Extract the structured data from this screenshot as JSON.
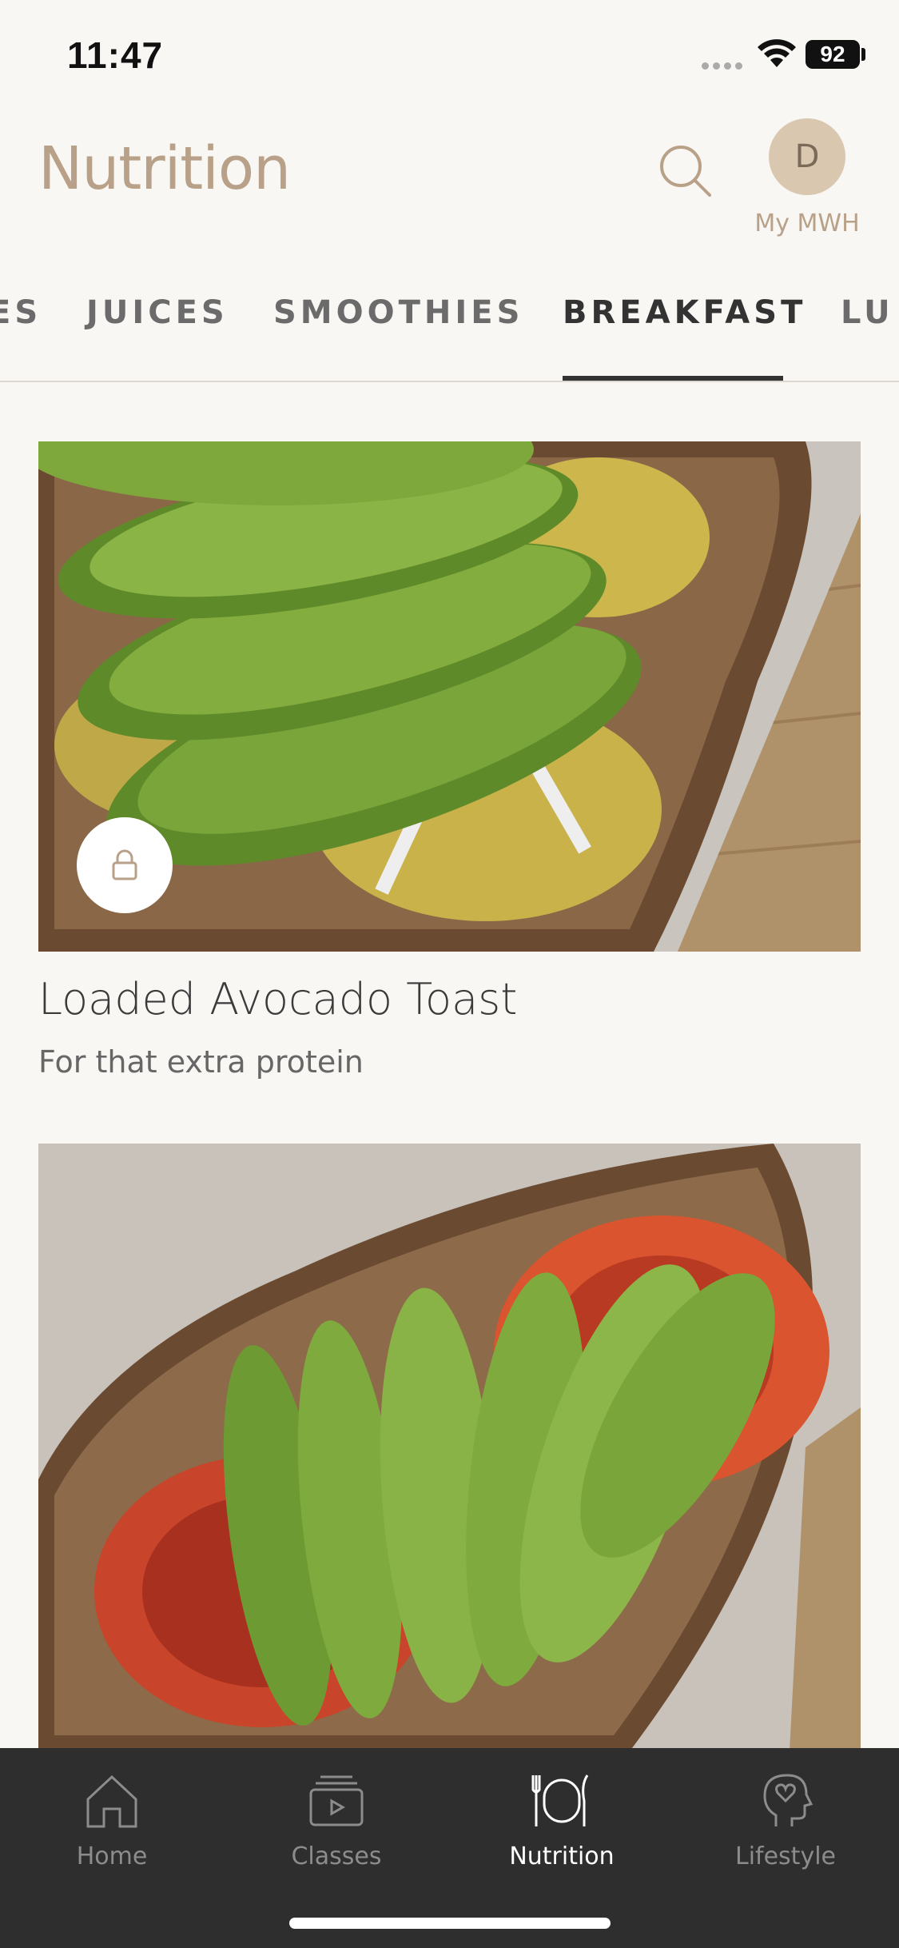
{
  "status_bar": {
    "time": "11:47",
    "battery": "92"
  },
  "header": {
    "title": "Nutrition",
    "avatar_initial": "D",
    "avatar_label": "My MWH"
  },
  "tabs": [
    {
      "label": "ES",
      "active": false
    },
    {
      "label": "JUICES",
      "active": false
    },
    {
      "label": "SMOOTHIES",
      "active": false
    },
    {
      "label": "BREAKFAST",
      "active": true
    },
    {
      "label": "LU",
      "active": false
    }
  ],
  "recipes": [
    {
      "title": "Loaded Avocado Toast",
      "subtitle": "For that extra protein",
      "locked": true,
      "image": "avocado-egg-toast"
    },
    {
      "title": "",
      "subtitle": "",
      "locked": false,
      "image": "avocado-tomato-toast"
    }
  ],
  "bottom_nav": [
    {
      "label": "Home",
      "icon": "home-icon",
      "active": false
    },
    {
      "label": "Classes",
      "icon": "classes-icon",
      "active": false
    },
    {
      "label": "Nutrition",
      "icon": "nutrition-icon",
      "active": true
    },
    {
      "label": "Lifestyle",
      "icon": "lifestyle-icon",
      "active": false
    }
  ],
  "colors": {
    "accent": "#b8a188",
    "nav_bg": "#2e2e2e",
    "background": "#f9f7f4"
  }
}
